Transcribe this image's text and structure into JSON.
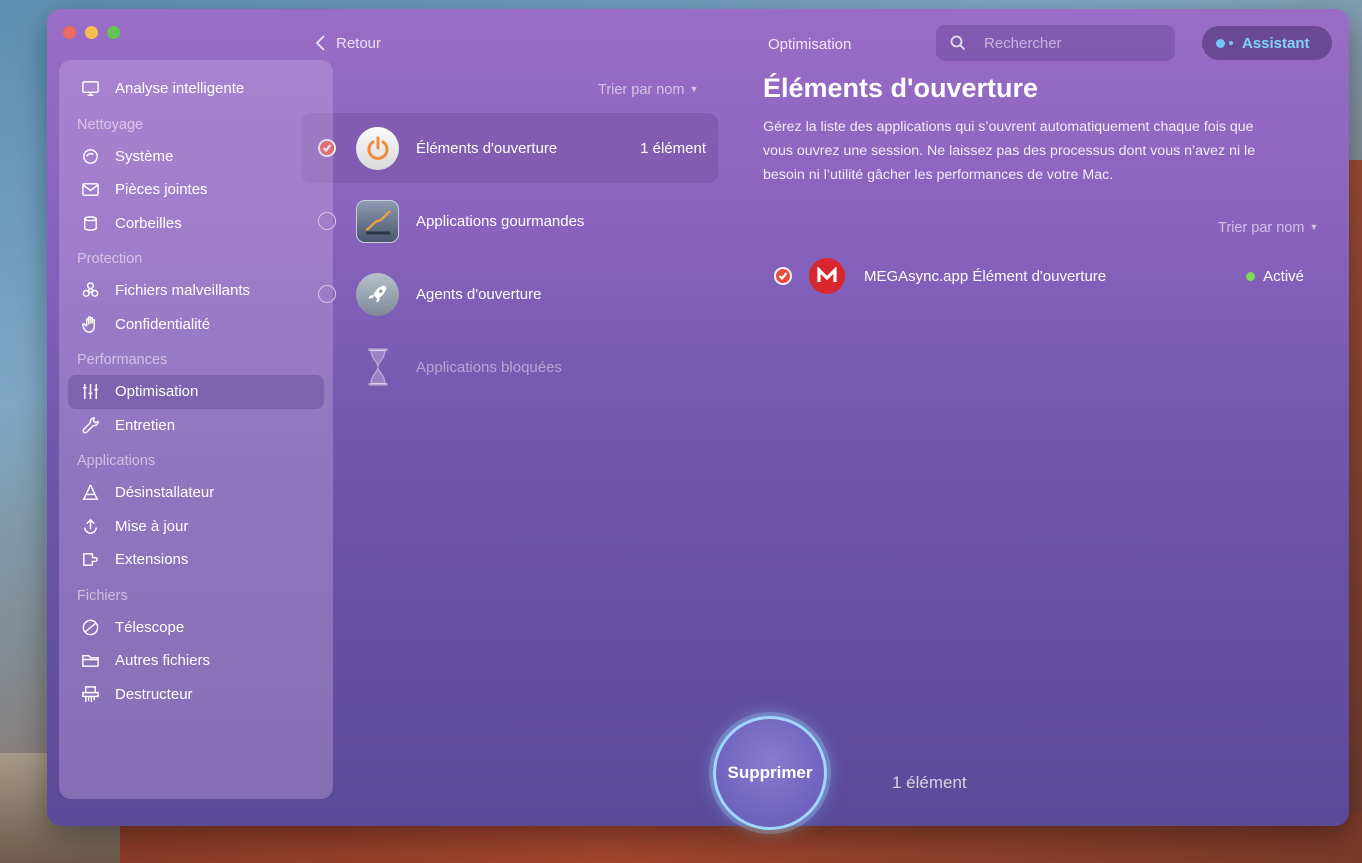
{
  "window": {
    "header": "Optimisation"
  },
  "nav": {
    "back_label": "Retour"
  },
  "search": {
    "placeholder": "Rechercher"
  },
  "assistant": {
    "label": "Assistant"
  },
  "sidebar": {
    "smart_scan": {
      "label": "Analyse intelligente",
      "icon": "monitor-icon"
    },
    "sections": [
      {
        "title": "Nettoyage",
        "items": [
          {
            "label": "Système",
            "icon": "system-junk-icon"
          },
          {
            "label": "Pièces jointes",
            "icon": "mail-attachment-icon"
          },
          {
            "label": "Corbeilles",
            "icon": "trash-icon"
          }
        ]
      },
      {
        "title": "Protection",
        "items": [
          {
            "label": "Fichiers malveillants",
            "icon": "biohazard-icon"
          },
          {
            "label": "Confidentialité",
            "icon": "hand-icon"
          }
        ]
      },
      {
        "title": "Performances",
        "items": [
          {
            "label": "Optimisation",
            "icon": "sliders-icon",
            "active": true
          },
          {
            "label": "Entretien",
            "icon": "wrench-icon"
          }
        ]
      },
      {
        "title": "Applications",
        "items": [
          {
            "label": "Désinstallateur",
            "icon": "uninstaller-icon"
          },
          {
            "label": "Mise à jour",
            "icon": "updater-icon"
          },
          {
            "label": "Extensions",
            "icon": "extensions-icon"
          }
        ]
      },
      {
        "title": "Fichiers",
        "items": [
          {
            "label": "Télescope",
            "icon": "lens-icon"
          },
          {
            "label": "Autres fichiers",
            "icon": "folder-icon"
          },
          {
            "label": "Destructeur",
            "icon": "shredder-icon"
          }
        ]
      }
    ]
  },
  "categories": {
    "sort_label": "Trier par nom",
    "items": [
      {
        "label": "Éléments d'ouverture",
        "count": "1 élément",
        "checked": true,
        "active": true,
        "icon": "power-icon"
      },
      {
        "label": "Applications gourmandes",
        "count": "",
        "checked": false,
        "icon": "chart-icon"
      },
      {
        "label": "Agents d'ouverture",
        "count": "",
        "checked": false,
        "icon": "rocket-icon"
      },
      {
        "label": "Applications bloquées",
        "count": "",
        "checked": false,
        "disabled": true,
        "icon": "hourglass-icon"
      }
    ]
  },
  "detail": {
    "title": "Éléments d'ouverture",
    "description": "Gérez la liste des applications qui s’ouvrent automatiquement chaque fois que vous ouvrez une session. Ne laissez pas des processus dont vous n’avez ni le besoin ni l’utilité gâcher les performances de votre Mac.",
    "sort_label": "Trier par nom",
    "items": [
      {
        "name": "MEGAsync.app Élément d'ouverture",
        "status": "Activé",
        "checked": true,
        "icon": "mega-logo-icon",
        "status_color": "#7ed957"
      }
    ]
  },
  "action": {
    "button_label": "Supprimer",
    "count": "1 élément"
  },
  "colors": {
    "accent_check": "#e94c3c",
    "assistant_text": "#7fd2ff",
    "button_ring": "#9fd7ff"
  }
}
